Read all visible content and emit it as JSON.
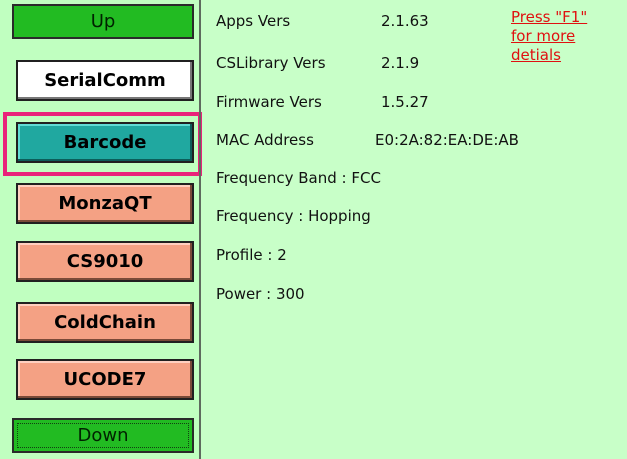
{
  "nav": {
    "up_label": "Up",
    "down_label": "Down"
  },
  "modes": [
    {
      "label": "SerialComm"
    },
    {
      "label": "Barcode"
    },
    {
      "label": "MonzaQT"
    },
    {
      "label": "CS9010"
    },
    {
      "label": "ColdChain"
    },
    {
      "label": "UCODE7"
    }
  ],
  "info": {
    "apps_label": "Apps Vers",
    "apps_value": "2.1.63",
    "cslib_label": "CSLibrary Vers",
    "cslib_value": "2.1.9",
    "firmware_label": "Firmware Vers",
    "firmware_value": "1.5.27",
    "mac_label": "MAC Address",
    "mac_value": "E0:2A:82:EA:DE:AB",
    "freq_band": "Frequency Band : FCC",
    "frequency": "Frequency : Hopping",
    "profile": "Profile : 2",
    "power": "Power : 300"
  },
  "help": {
    "line1": "Press \"F1\"",
    "line2": "for more",
    "line3": "detials"
  },
  "colors": {
    "background": "#c8ffc8",
    "nav_green": "#22bb22",
    "selected_teal": "#20a8a0",
    "mode_salmon": "#f4a184",
    "highlight_pink": "#e9227a",
    "help_red": "#e01010"
  }
}
